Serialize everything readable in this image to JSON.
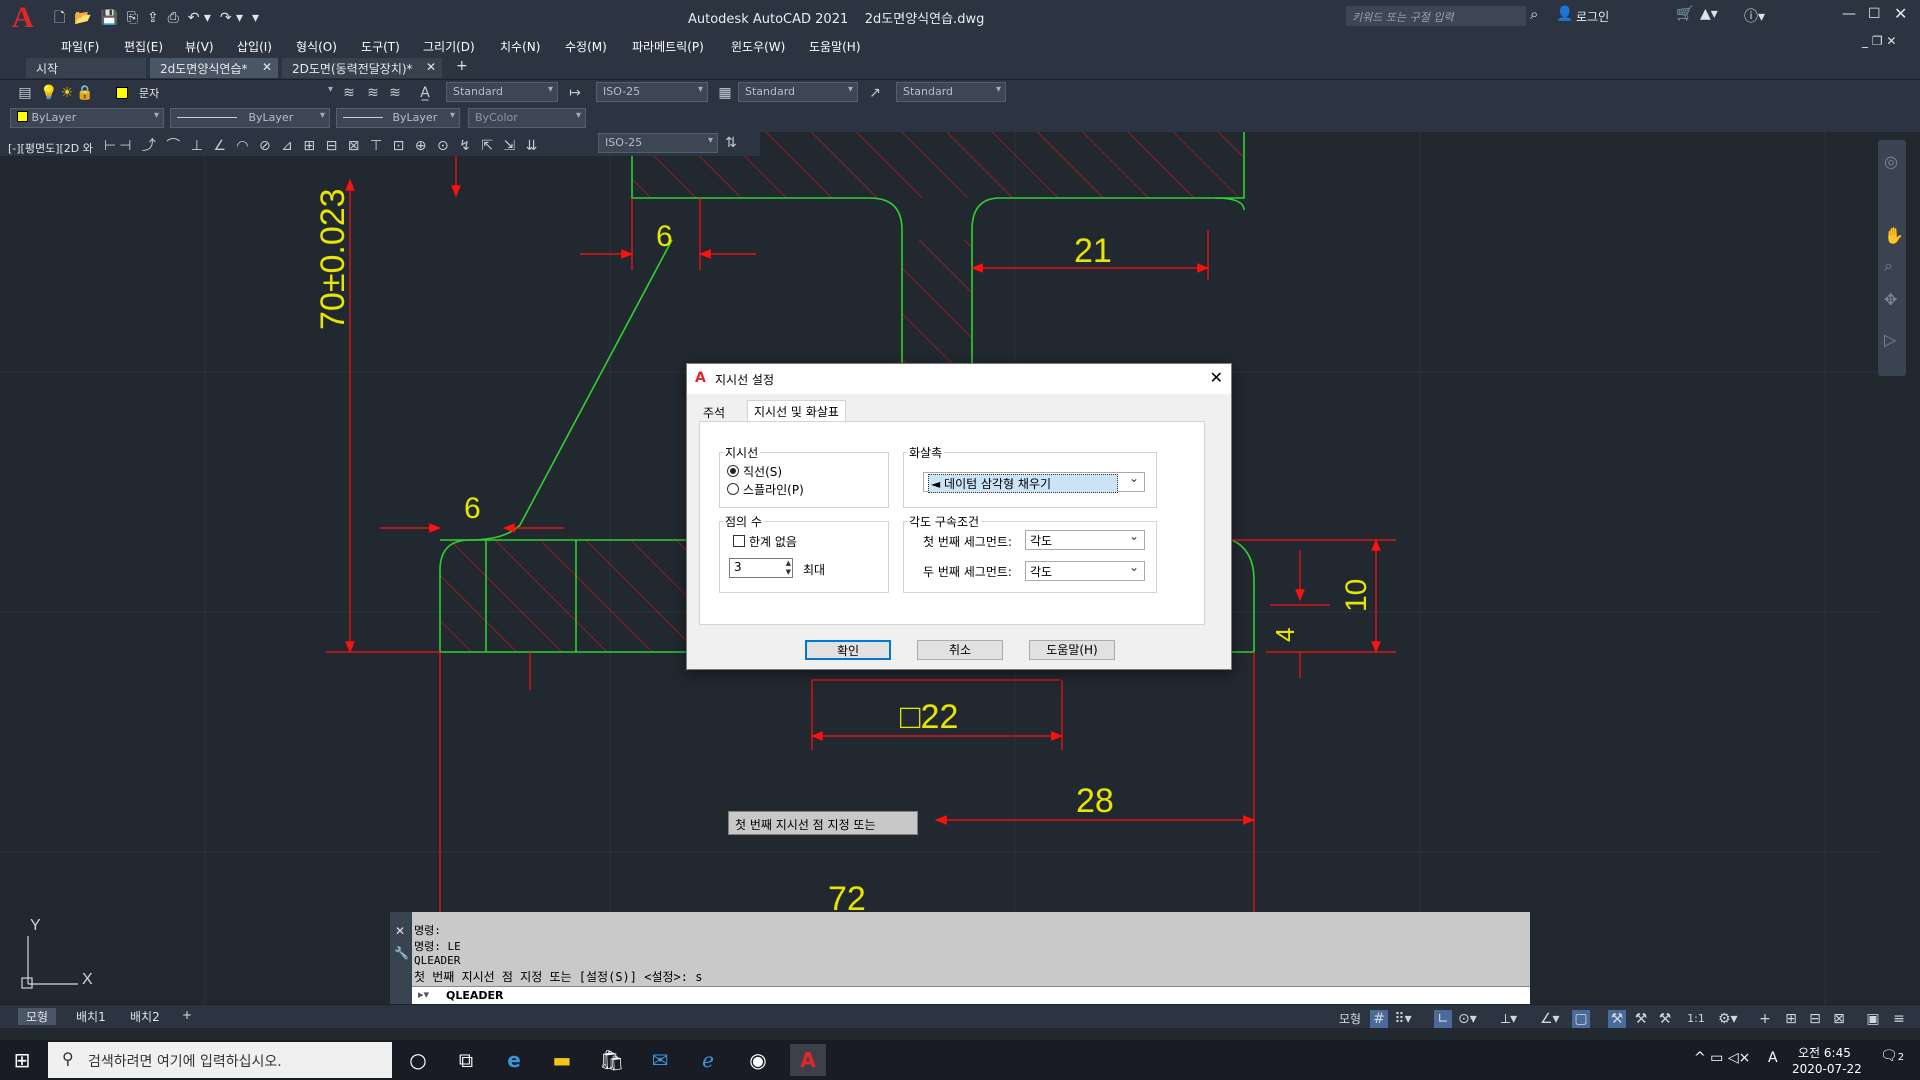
{
  "window": {
    "title": "Autodesk AutoCAD 2021    2d도면양식연습.dwg",
    "search_placeholder": "키워드 또는 구절 입력",
    "login": "로그인"
  },
  "menu": [
    "파일(F)",
    "편집(E)",
    "뷰(V)",
    "삽입(I)",
    "형식(O)",
    "도구(T)",
    "그리기(D)",
    "치수(N)",
    "수정(M)",
    "파라메트릭(P)",
    "윈도우(W)",
    "도움말(H)"
  ],
  "doc_tabs": [
    "시작",
    "2d도면양식연습*",
    "2D도면(동력전달장치)*"
  ],
  "toolbar": {
    "layer": "문자",
    "text_style": "Standard",
    "dim_style": "ISO-25",
    "table_style": "Standard",
    "mleader_style": "Standard",
    "color": "ByLayer",
    "linetype": "ByLayer",
    "lineweight": "ByLayer",
    "plotstyle": "ByColor",
    "dim_style2": "ISO-25",
    "viewport_label": "[-][평면도][2D 와"
  },
  "drawing": {
    "dims": {
      "d70": "70±0.023",
      "d6a": "6",
      "d21": "21",
      "d6b": "6",
      "d10": "10",
      "d4": "4",
      "d22": "□22",
      "d28": "28",
      "d72": "72"
    },
    "colors": {
      "green": "#2ed12e",
      "red": "#ff1010",
      "yellow": "#e6e600"
    }
  },
  "dialog": {
    "title": "지시선 설정",
    "tabs": [
      "주석",
      "지시선 및 화살표"
    ],
    "leader_group": "지시선",
    "straight": "직선(S)",
    "spline": "스플라인(P)",
    "arrow_group": "화살촉",
    "arrow_value": "◄ 데이텀 삼각형 채우기",
    "points_group": "점의 수",
    "no_limit": "한계 없음",
    "points_value": "3",
    "max_label": "최대",
    "angle_group": "각도 구속조건",
    "first_seg": "첫 번째 세그먼트:",
    "first_seg_value": "각도",
    "second_seg": "두 번째 세그먼트:",
    "second_seg_value": "각도",
    "ok": "확인",
    "cancel": "취소",
    "help": "도움말(H)"
  },
  "tooltip": "첫 번째 지시선 점 지정 또는",
  "command": {
    "lines": [
      "명령:",
      "명령: LE",
      "QLEADER",
      "첫 번째 지시선 점 지정 또는 [설정(S)] <설정>: s"
    ],
    "input": "QLEADER"
  },
  "layout_tabs": [
    "모형",
    "배치1",
    "배치2"
  ],
  "status": {
    "model": "모형",
    "scale": "1:1"
  },
  "taskbar": {
    "search_placeholder": "검색하려면 여기에 입력하십시오.",
    "time": "오전 6:45",
    "date": "2020-07-22",
    "ime": "A",
    "notifications": "2"
  },
  "ucs": {
    "x": "X",
    "y": "Y"
  }
}
